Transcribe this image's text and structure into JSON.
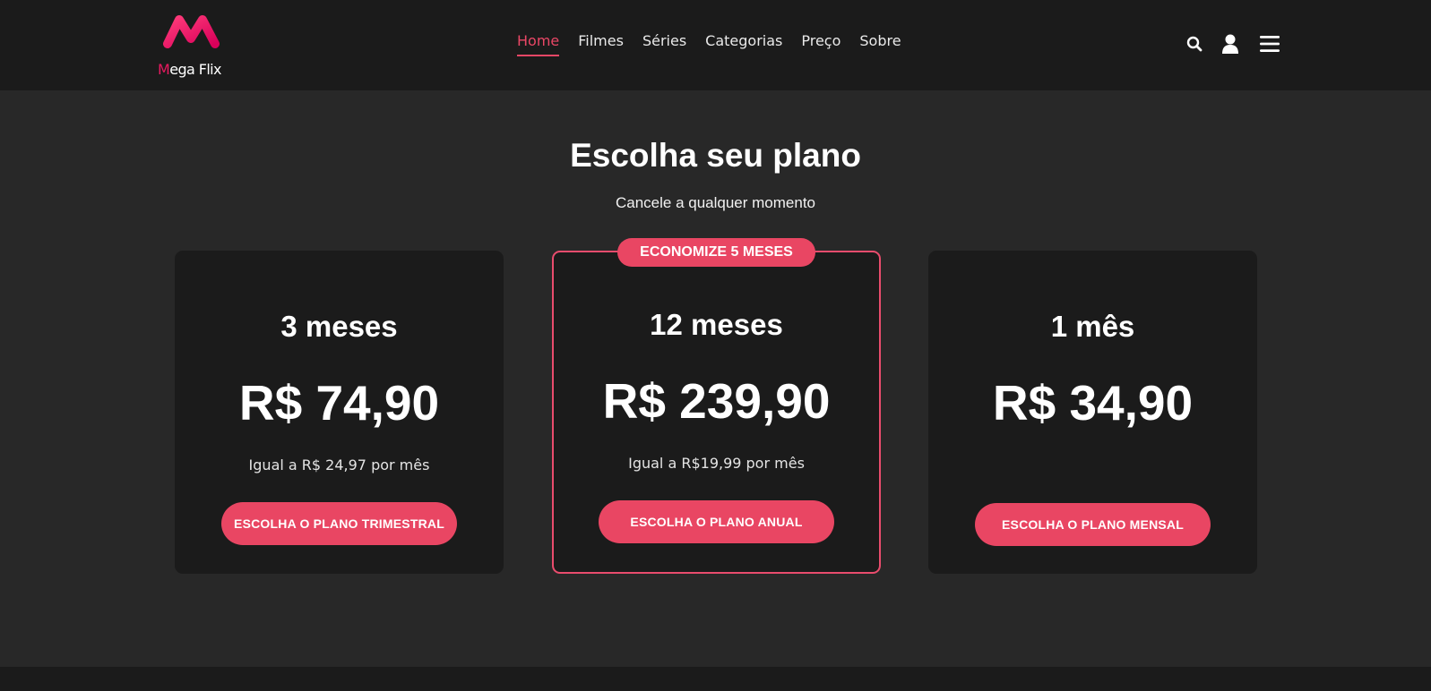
{
  "brand": {
    "logo_text_first": "M",
    "logo_text_rest": "ega Flix",
    "accent_color": "#e8195f",
    "button_color": "#e94663"
  },
  "nav": {
    "items": [
      {
        "label": "Home",
        "active": true
      },
      {
        "label": "Filmes",
        "active": false
      },
      {
        "label": "Séries",
        "active": false
      },
      {
        "label": "Categorias",
        "active": false
      },
      {
        "label": "Preço",
        "active": false
      },
      {
        "label": "Sobre",
        "active": false
      }
    ],
    "icons": [
      "search-icon",
      "user-icon",
      "menu-icon"
    ]
  },
  "main": {
    "title": "Escolha seu plano",
    "subtitle": "Cancele a qualquer momento"
  },
  "plans": [
    {
      "period": "3 meses",
      "price": "R$ 74,90",
      "note": "Igual a R$ 24,97 por mês",
      "button": "ESCOLHA O PLANO TRIMESTRAL"
    },
    {
      "badge": "ECONOMIZE 5 MESES",
      "period": "12 meses",
      "price": "R$ 239,90",
      "note": "Igual a R$19,99 por mês",
      "button": "ESCOLHA O PLANO ANUAL"
    },
    {
      "period": "1 mês",
      "price": "R$ 34,90",
      "note": "",
      "button": "ESCOLHA O PLANO MENSAL"
    }
  ]
}
